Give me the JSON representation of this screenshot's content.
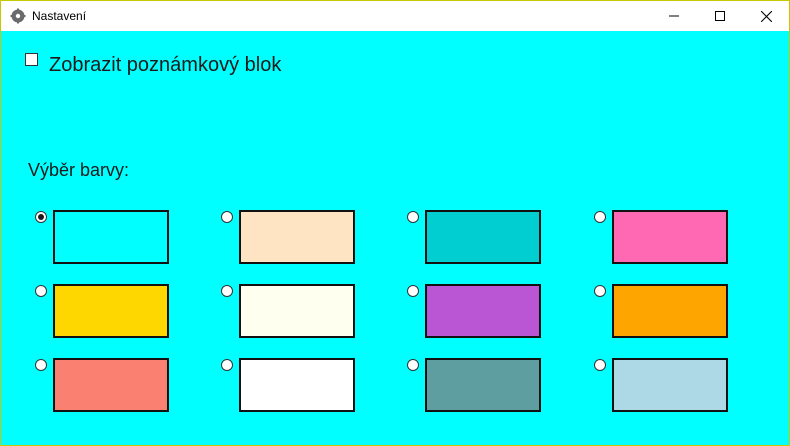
{
  "window": {
    "title": "Nastavení",
    "icon": "gear-icon",
    "controls": {
      "minimize": "minimize-icon",
      "maximize": "maximize-icon",
      "close": "close-icon"
    }
  },
  "settings": {
    "show_notepad_label": "Zobrazit poznámkový blok",
    "show_notepad_checked": false,
    "color_heading": "Výběr barvy:",
    "colors": [
      {
        "color": "#00FFFF",
        "selected": true
      },
      {
        "color": "#FFE4C4",
        "selected": false
      },
      {
        "color": "#00CED1",
        "selected": false
      },
      {
        "color": "#FF69B4",
        "selected": false
      },
      {
        "color": "#FFD700",
        "selected": false
      },
      {
        "color": "#FFFFF0",
        "selected": false
      },
      {
        "color": "#BA55D3",
        "selected": false
      },
      {
        "color": "#FFA500",
        "selected": false
      },
      {
        "color": "#FA8072",
        "selected": false
      },
      {
        "color": "#FFFFFF",
        "selected": false
      },
      {
        "color": "#5F9EA0",
        "selected": false
      },
      {
        "color": "#ADD8E6",
        "selected": false
      }
    ]
  },
  "theme": {
    "background": "#00FFFF"
  }
}
